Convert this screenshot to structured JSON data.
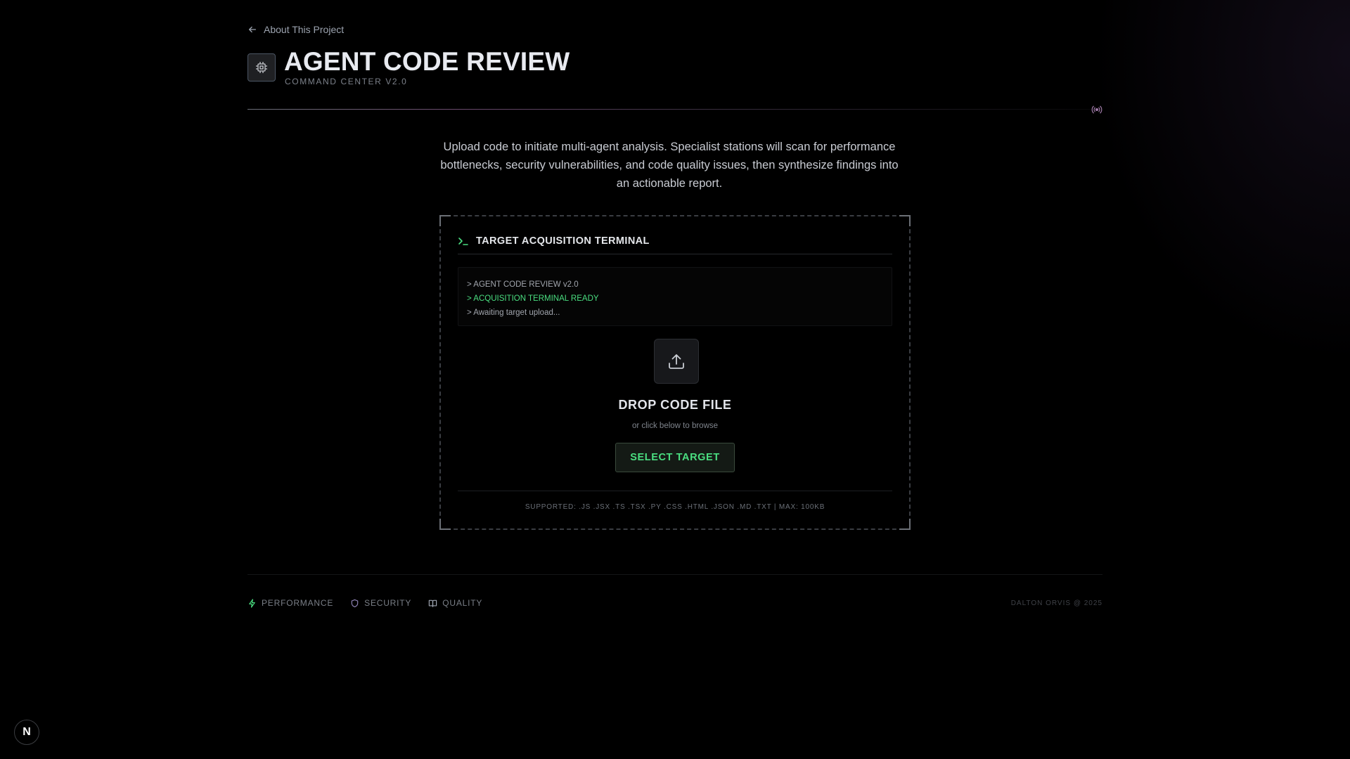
{
  "nav": {
    "back_label": "About This Project"
  },
  "header": {
    "title": "AGENT CODE REVIEW",
    "subtitle": "COMMAND CENTER V2.0",
    "icon": "cpu-chip-icon",
    "status_icon": "broadcast-icon"
  },
  "intro": {
    "text": "Upload code to initiate multi-agent analysis. Specialist stations will scan for performance bottlenecks, security vulnerabilities, and code quality issues, then synthesize findings into an actionable report."
  },
  "terminal": {
    "title": "TARGET ACQUISITION TERMINAL",
    "log_lines": [
      "> AGENT CODE REVIEW v2.0",
      "> ACQUISITION TERMINAL READY",
      "> Awaiting target upload..."
    ],
    "drop_title": "DROP CODE FILE",
    "drop_subtitle": "or click below to browse",
    "select_button": "SELECT TARGET",
    "supported": "SUPPORTED: .JS .JSX .TS .TSX .PY .CSS .HTML .JSON .MD .TXT  |  MAX: 100KB"
  },
  "footer": {
    "items": [
      {
        "label": "PERFORMANCE",
        "icon": "lightning-icon"
      },
      {
        "label": "SECURITY",
        "icon": "shield-icon"
      },
      {
        "label": "QUALITY",
        "icon": "book-icon"
      }
    ],
    "copyright": "DALTON ORVIS @ 2025"
  },
  "badge": {
    "label": "N"
  },
  "colors": {
    "accent_green": "#4ade80",
    "background": "#000000",
    "accent_purple": "#6b4a6e"
  }
}
